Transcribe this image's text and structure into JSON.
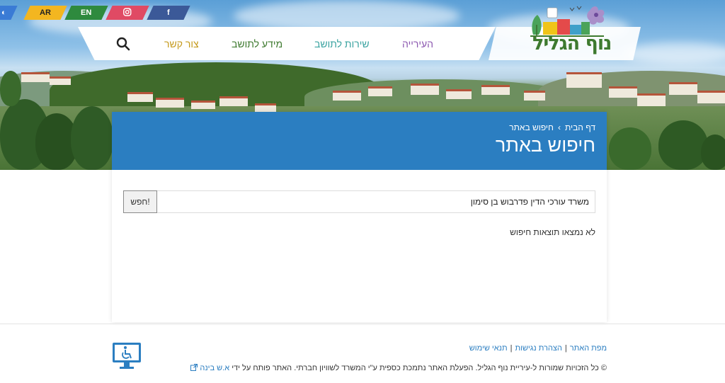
{
  "social": {
    "accessibility": "accessibility-icon",
    "ar": "AR",
    "en": "EN",
    "instagram": "instagram-icon",
    "facebook": "f"
  },
  "nav": {
    "items": [
      {
        "label": "העירייה",
        "color": "#8c58b0"
      },
      {
        "label": "שירות לתושב",
        "color": "#3aa3a0"
      },
      {
        "label": "מידע לתושב",
        "color": "#3e7a2f"
      },
      {
        "label": "צור קשר",
        "color": "#c59a1c"
      }
    ]
  },
  "logo": {
    "text": "נוף הגליל"
  },
  "header": {
    "breadcrumb_home": "דף הבית",
    "breadcrumb_sep": "›",
    "breadcrumb_current": "חיפוש באתר",
    "title": "חיפוש באתר"
  },
  "search": {
    "value": "משרד עורכי הדין פדרבוש בן סימון",
    "button_label": "חפש!"
  },
  "results": {
    "message": "לא נמצאו תוצאות חיפוש"
  },
  "footer": {
    "links": [
      "מפת האתר",
      "הצהרת נגישות",
      "תנאי שימוש"
    ],
    "copyright_prefix": "© כל הזכויות שמורות ל-עיריית נוף הגליל. הפעלת האתר נתמכת כספית ע\"י המשרד לשוויון חברתי. האתר פותח על ידי",
    "developer": "א.ש בינה"
  },
  "colors": {
    "header_blue": "#2b7ec1",
    "ar_yellow": "#f3b620",
    "en_green": "#2e8a3e",
    "instagram_red": "#e04a64",
    "facebook_blue": "#3b5998"
  }
}
